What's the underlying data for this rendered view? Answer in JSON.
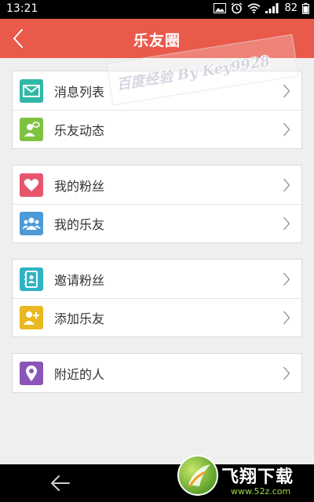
{
  "status_bar": {
    "time": "13:21",
    "battery": "82"
  },
  "header": {
    "title": "乐友圈"
  },
  "watermark": {
    "text": "百度经验 By Key9928"
  },
  "groups": [
    {
      "items": [
        {
          "label": "消息列表",
          "icon": "envelope-icon",
          "color": "#2fb8a8"
        },
        {
          "label": "乐友动态",
          "icon": "person-chat-icon",
          "color": "#7fc241"
        }
      ]
    },
    {
      "items": [
        {
          "label": "我的粉丝",
          "icon": "heart-icon",
          "color": "#e8546e"
        },
        {
          "label": "我的乐友",
          "icon": "group-icon",
          "color": "#4b9bd8"
        }
      ]
    },
    {
      "items": [
        {
          "label": "邀请粉丝",
          "icon": "contacts-book-icon",
          "color": "#2fb3c4"
        },
        {
          "label": "添加乐友",
          "icon": "add-person-icon",
          "color": "#e9b823"
        }
      ]
    },
    {
      "items": [
        {
          "label": "附近的人",
          "icon": "location-pin-icon",
          "color": "#8a55b8"
        }
      ]
    }
  ],
  "site_logo": {
    "name": "飞翔下载",
    "url": "www.52z.com"
  }
}
